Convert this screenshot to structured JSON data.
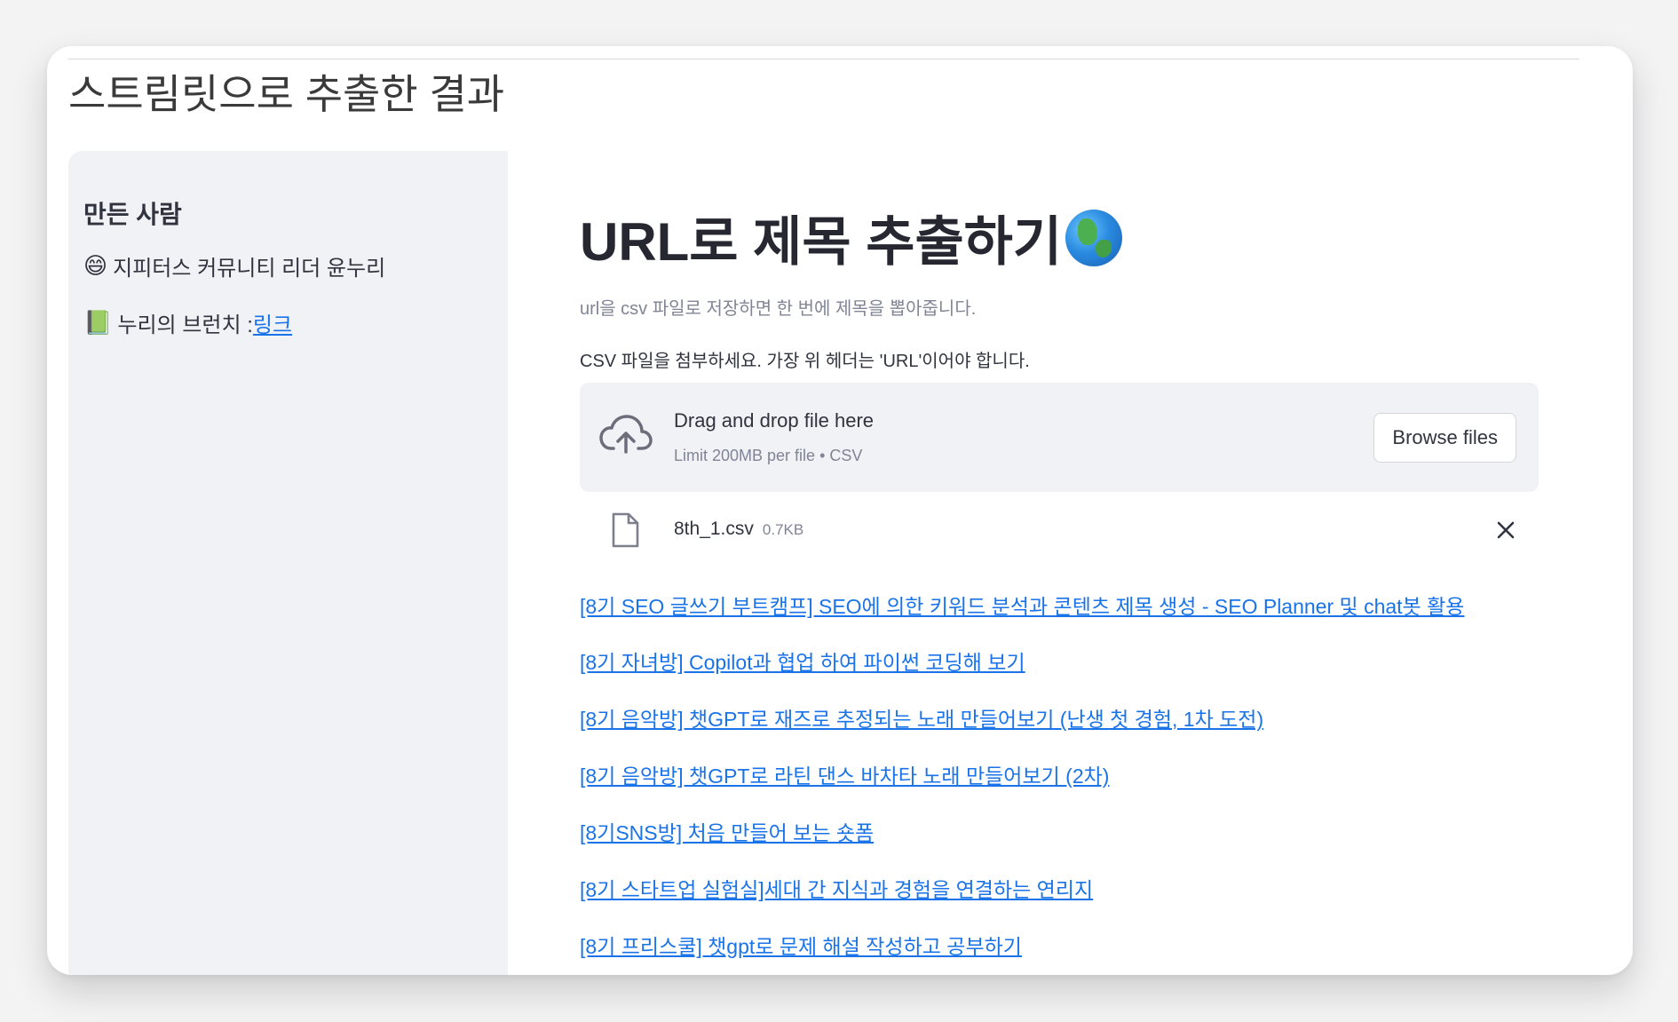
{
  "window": {
    "title": "스트림릿으로 추출한 결과"
  },
  "sidebar": {
    "heading": "만든 사람",
    "author": {
      "emoji": "😄",
      "text": "지피터스 커뮤니티 리더 윤누리"
    },
    "branch": {
      "emoji": "📗",
      "text": "누리의 브런치 : ",
      "link_label": "링크"
    }
  },
  "main": {
    "title": "URL로 제목 추출하기",
    "title_emoji_icon": "globe-icon",
    "subtitle": "url을 csv 파일로 저장하면 한 번에 제목을 뽑아줍니다.",
    "uploader": {
      "label": "CSV 파일을 첨부하세요. 가장 위 헤더는 'URL'이어야 합니다.",
      "drop_text": "Drag and drop file here",
      "limit_text": "Limit 200MB per file • CSV",
      "browse_label": "Browse files"
    },
    "file": {
      "name": "8th_1.csv",
      "size": "0.7KB"
    },
    "results": [
      "[8기 SEO 글쓰기 부트캠프] SEO에 의한 키워드 분석과 콘텐츠 제목 생성 - SEO Planner 및 chat봇 활용",
      "[8기 자녀방] Copilot과 협업 하여 파이썬 코딩해 보기",
      "[8기 음악방] 챗GPT로 재즈로 추정되는 노래 만들어보기 (난생 첫 경험, 1차 도전)",
      "[8기 음악방] 챗GPT로 라틴 댄스 바차타 노래 만들어보기 (2차)",
      "[8기SNS방] 처음 만들어 보는 숏폼",
      "[8기 스타트업 실험실]세대 간 지식과 경험을 연결하는 연리지",
      "[8기 프리스쿨] 챗gpt로 문제 해설 작성하고 공부하기"
    ]
  },
  "colors": {
    "link": "#1a73e8",
    "sidebar_bg": "#f0f2f6",
    "text": "#31333f",
    "muted": "#808495"
  }
}
